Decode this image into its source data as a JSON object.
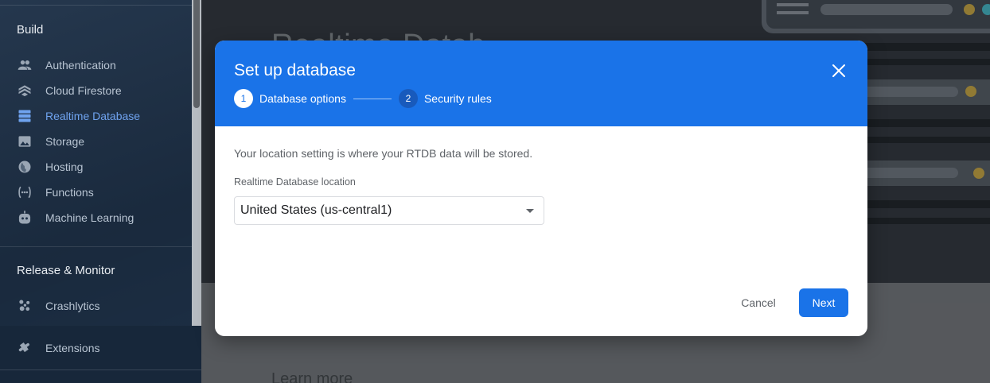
{
  "sidebar": {
    "build_title": "Build",
    "build_items": [
      {
        "label": "Authentication",
        "icon": "people-icon"
      },
      {
        "label": "Cloud Firestore",
        "icon": "firestore-icon"
      },
      {
        "label": "Realtime Database",
        "icon": "database-icon",
        "active": true
      },
      {
        "label": "Storage",
        "icon": "image-icon"
      },
      {
        "label": "Hosting",
        "icon": "globe-icon"
      },
      {
        "label": "Functions",
        "icon": "functions-icon"
      },
      {
        "label": "Machine Learning",
        "icon": "robot-icon"
      }
    ],
    "release_title": "Release & Monitor",
    "release_items": [
      {
        "label": "Crashlytics",
        "icon": "crashlytics-icon"
      }
    ],
    "footer_item": {
      "label": "Extensions",
      "icon": "extensions-icon"
    }
  },
  "main": {
    "hero_title": "Realtime Datab",
    "learn_more": "Learn more"
  },
  "dialog": {
    "title": "Set up database",
    "steps": [
      {
        "number": "1",
        "label": "Database options",
        "active": true
      },
      {
        "number": "2",
        "label": "Security rules",
        "active": false
      }
    ],
    "description": "Your location setting is where your RTDB data will be stored.",
    "location_label": "Realtime Database location",
    "location_value": "United States (us-central1)",
    "cancel_label": "Cancel",
    "next_label": "Next"
  },
  "colors": {
    "primary": "#1a73e8",
    "sidebar_bg": "#1e3148",
    "active_nav": "#6fa3ef"
  }
}
